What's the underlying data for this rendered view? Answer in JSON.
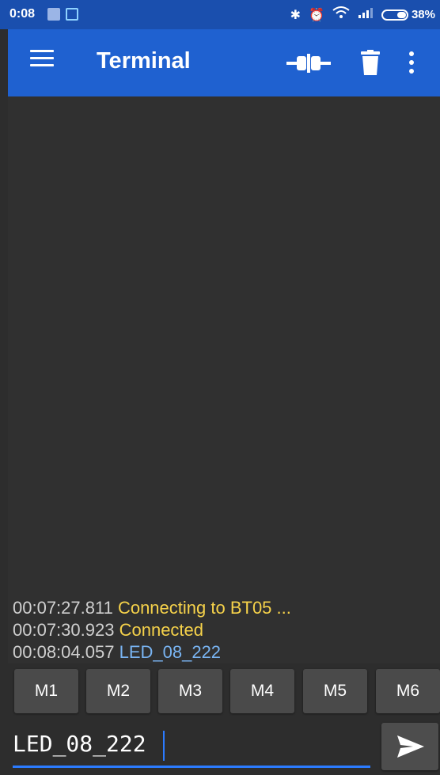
{
  "status_bar": {
    "time": "0:08",
    "battery_percent": "38%",
    "battery_level": 0.38,
    "icons": [
      "notification-icon",
      "sync-icon",
      "bluetooth-icon",
      "alarm-off-icon",
      "wifi-icon",
      "signal-icon",
      "battery-icon"
    ]
  },
  "app_bar": {
    "title": "Terminal",
    "menu_icon": "hamburger-menu-icon",
    "connect_icon": "plug-connect-icon",
    "delete_icon": "trash-icon",
    "more_icon": "more-vertical-icon"
  },
  "colors": {
    "app_bar": "#1f61d0",
    "status_bar": "#1a4fae",
    "background": "#2d2d2d",
    "status_text": "#f6d24a",
    "received_text": "#79b4f2",
    "accent": "#2b7bff"
  },
  "terminal": {
    "lines": [
      {
        "timestamp": "00:07:27.811",
        "text": "Connecting to BT05 ..."
      },
      {
        "timestamp": "00:07:30.923",
        "text": "Connected"
      },
      {
        "timestamp": "00:08:04.057",
        "text": "LED_08_222"
      }
    ]
  },
  "macros": [
    "M1",
    "M2",
    "M3",
    "M4",
    "M5",
    "M6"
  ],
  "input": {
    "value": "LED_08_222",
    "send_icon": "send-icon"
  }
}
